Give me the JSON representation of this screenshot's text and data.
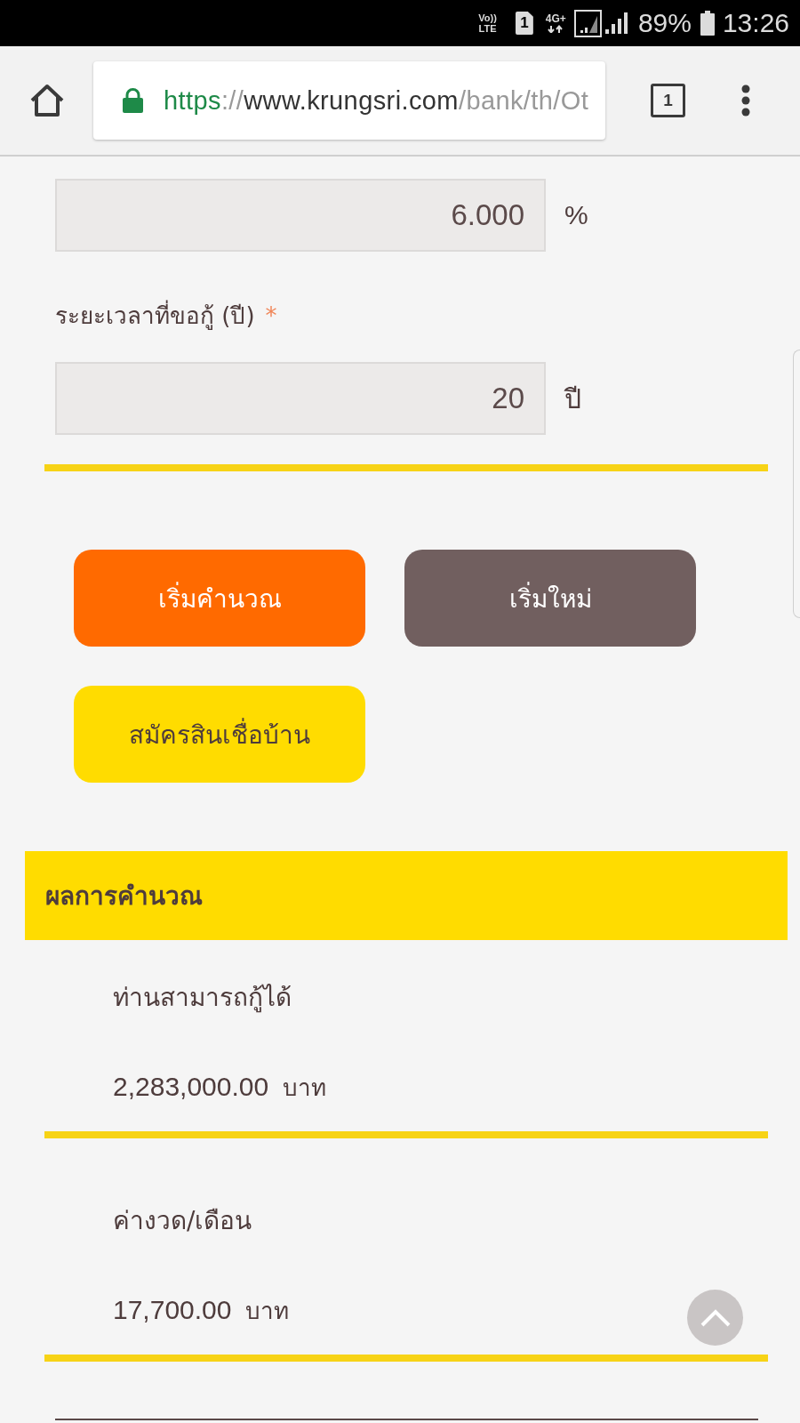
{
  "status_bar": {
    "volte": [
      "Vo))",
      "LTE"
    ],
    "sim": "1",
    "network_type": "4G+",
    "battery_percent": "89%",
    "time": "13:26"
  },
  "browser": {
    "secure": true,
    "url": {
      "scheme": "https",
      "separator": "://",
      "host": "www.krungsri.com",
      "path": "/bank/th/Ot"
    },
    "tab_count": "1"
  },
  "form": {
    "fields": [
      {
        "value": "6.000",
        "unit": "%"
      },
      {
        "label": "ระยะเวลาที่ขอกู้ (ปี)",
        "required_mark": "*",
        "value": "20",
        "unit": "ปี"
      }
    ]
  },
  "buttons": [
    {
      "label": "เริ่มคำนวณ",
      "kind": "primary"
    },
    {
      "label": "เริ่มใหม่",
      "kind": "secondary"
    },
    {
      "label": "สมัครสินเชื่อบ้าน",
      "kind": "apply"
    }
  ],
  "results": {
    "title": "ผลการคำนวณ",
    "items": [
      {
        "label": "ท่านสามารถกู้ได้",
        "value": "2,283,000.00",
        "unit": "บาท"
      },
      {
        "label": "ค่างวด/เดือน",
        "value": "17,700.00",
        "unit": "บาท"
      }
    ]
  }
}
